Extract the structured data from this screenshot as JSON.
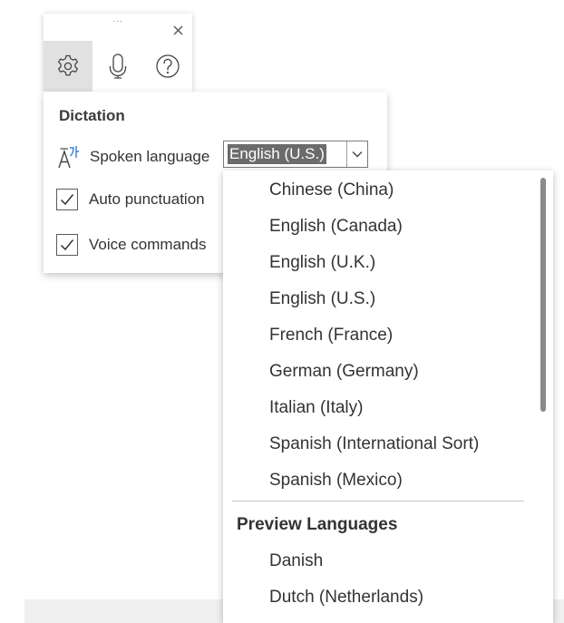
{
  "toolbar": {
    "grip": "...",
    "buttons": [
      {
        "name": "settings",
        "icon": "gear-icon",
        "active": true
      },
      {
        "name": "microphone",
        "icon": "microphone-icon",
        "active": false
      },
      {
        "name": "help",
        "icon": "question-icon",
        "active": false
      }
    ]
  },
  "panel": {
    "title": "Dictation",
    "language_label": "Spoken language",
    "language_value": "English (U.S.)",
    "options": [
      {
        "label": "Auto punctuation",
        "checked": true
      },
      {
        "label": "Voice commands",
        "checked": true
      }
    ]
  },
  "dropdown": {
    "items": [
      "Chinese (China)",
      "English (Canada)",
      "English (U.K.)",
      "English (U.S.)",
      "French (France)",
      "German (Germany)",
      "Italian (Italy)",
      "Spanish (International Sort)",
      "Spanish (Mexico)"
    ],
    "preview_header": "Preview Languages",
    "preview_items": [
      "Danish",
      "Dutch (Netherlands)"
    ]
  },
  "colors": {
    "selection_bg": "#6b6b6b",
    "icon_accent": "#3a7bd5",
    "active_button_bg": "#e1e1e1"
  }
}
